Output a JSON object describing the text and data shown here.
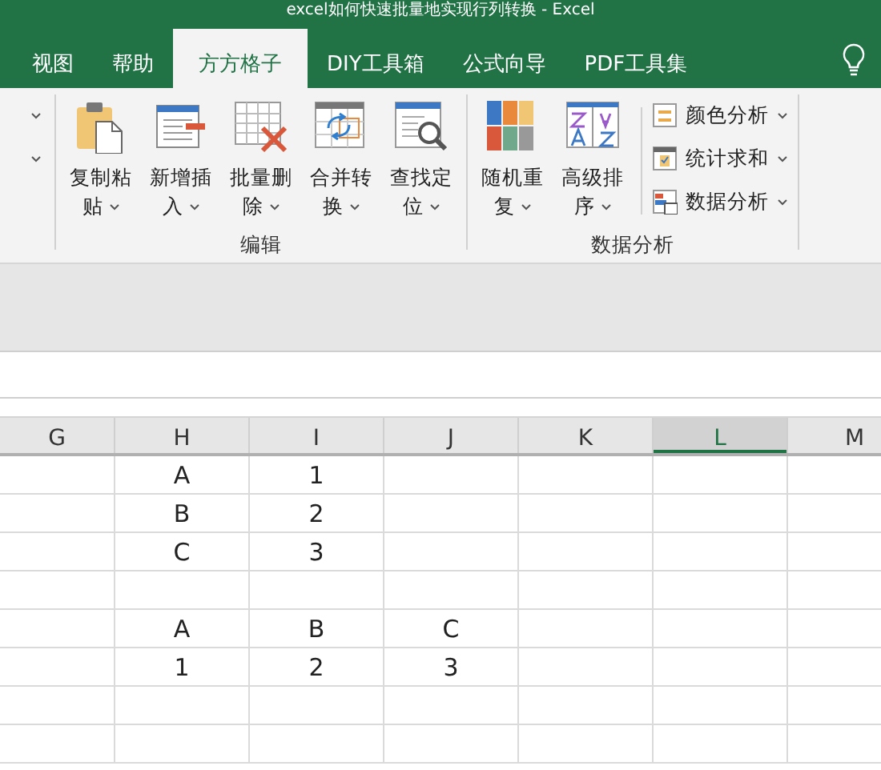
{
  "window": {
    "title": "excel如何快速批量地实现行列转换 - Excel"
  },
  "tabs": [
    {
      "label": "视图",
      "selected": false
    },
    {
      "label": "帮助",
      "selected": false
    },
    {
      "label": "方方格子",
      "selected": true
    },
    {
      "label": "DIY工具箱",
      "selected": false
    },
    {
      "label": "公式向导",
      "selected": false
    },
    {
      "label": "PDF工具集",
      "selected": false
    }
  ],
  "ribbon_groups": [
    {
      "label": "编辑",
      "buttons": [
        {
          "kind": "large",
          "label": "复制粘贴"
        },
        {
          "kind": "large",
          "label": "新增插入"
        },
        {
          "kind": "large",
          "label": "批量删除"
        },
        {
          "kind": "large",
          "label": "合并转换"
        },
        {
          "kind": "large",
          "label": "查找定位"
        }
      ]
    },
    {
      "label": "数据分析",
      "buttons": [
        {
          "kind": "large",
          "label": "随机重复"
        },
        {
          "kind": "large",
          "label": "高级排序"
        },
        {
          "kind": "small",
          "label": "颜色分析"
        },
        {
          "kind": "small",
          "label": "统计求和"
        },
        {
          "kind": "small",
          "label": "数据分析"
        }
      ]
    }
  ],
  "sheet": {
    "columns": [
      {
        "label": "G",
        "selected": false
      },
      {
        "label": "H",
        "selected": false
      },
      {
        "label": "I",
        "selected": false
      },
      {
        "label": "J",
        "selected": false
      },
      {
        "label": "K",
        "selected": false
      },
      {
        "label": "L",
        "selected": true
      },
      {
        "label": "M",
        "selected": false
      }
    ],
    "rows": [
      [
        null,
        "A",
        "1",
        null,
        null,
        null,
        null
      ],
      [
        null,
        "B",
        "2",
        null,
        null,
        null,
        null
      ],
      [
        null,
        "C",
        "3",
        null,
        null,
        null,
        null
      ],
      [
        null,
        null,
        null,
        null,
        null,
        null,
        null
      ],
      [
        null,
        "A",
        "B",
        "C",
        null,
        null,
        null
      ],
      [
        null,
        "1",
        "2",
        "3",
        null,
        null,
        null
      ],
      [
        null,
        null,
        null,
        null,
        null,
        null,
        null
      ],
      [
        null,
        null,
        null,
        null,
        null,
        null,
        null
      ]
    ]
  }
}
